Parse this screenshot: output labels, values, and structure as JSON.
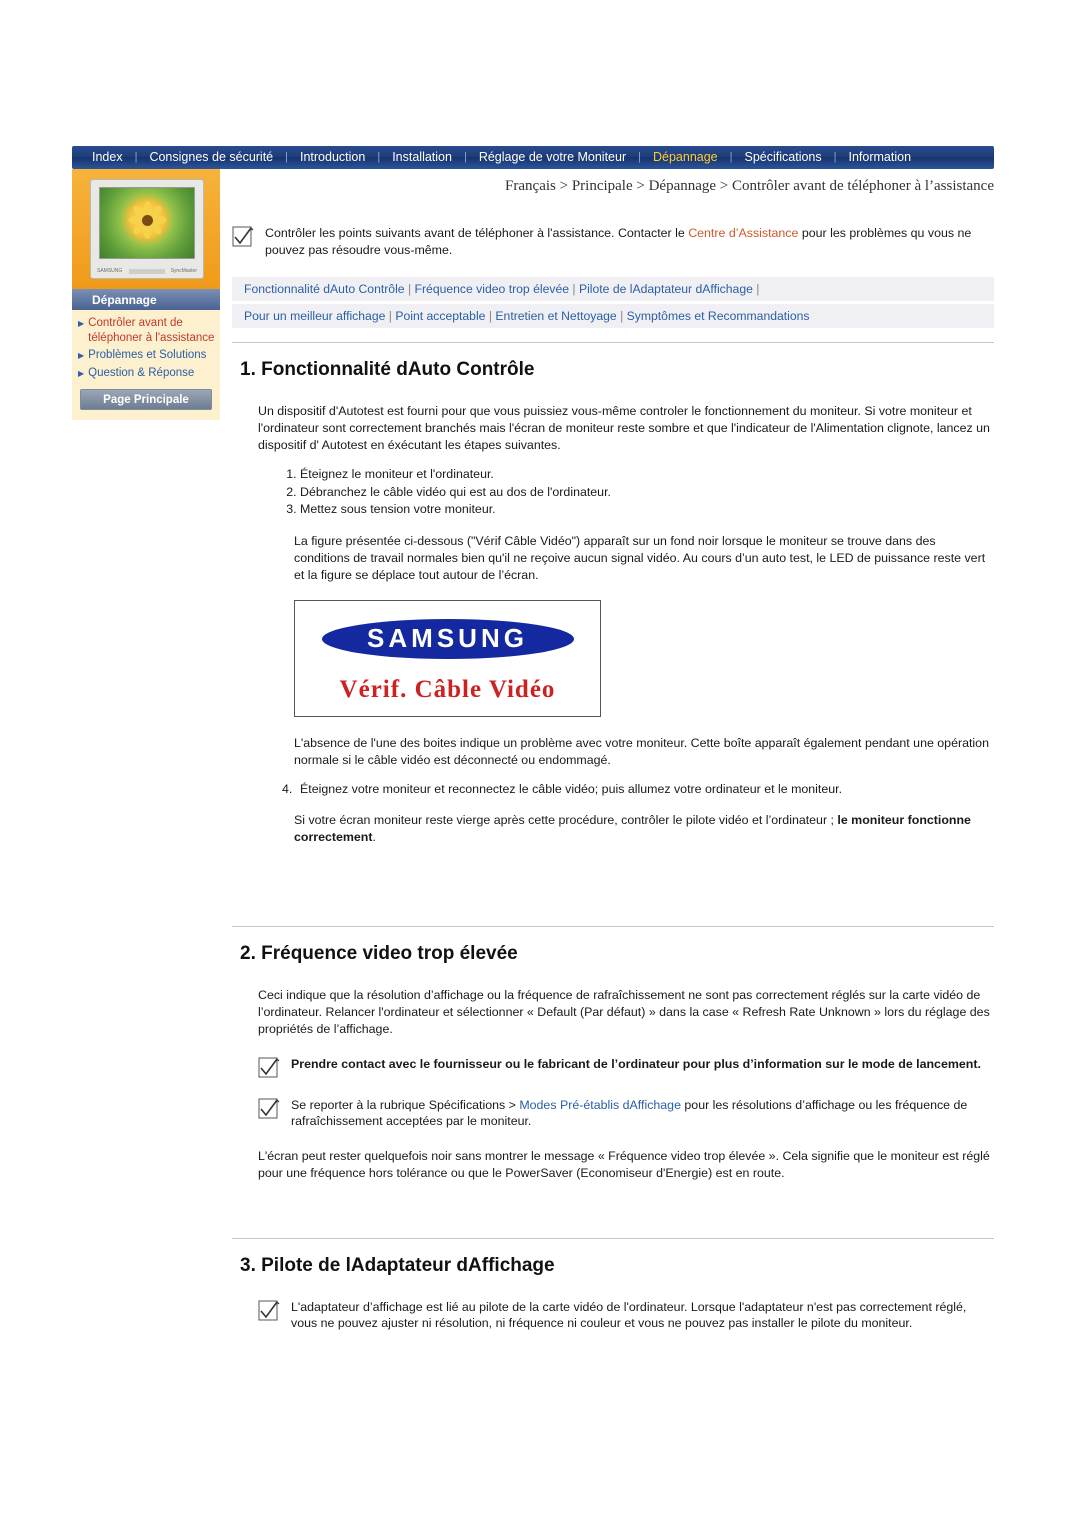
{
  "nav": {
    "items": [
      {
        "label": "Index",
        "active": false
      },
      {
        "label": "Consignes de sécurité",
        "active": false
      },
      {
        "label": "Introduction",
        "active": false
      },
      {
        "label": "Installation",
        "active": false
      },
      {
        "label": "Réglage de votre Moniteur",
        "active": false
      },
      {
        "label": "Dépannage",
        "active": true
      },
      {
        "label": "Spécifications",
        "active": false
      },
      {
        "label": "Information",
        "active": false
      }
    ]
  },
  "sidebar": {
    "monitor_label_left": "SAMSUNG",
    "monitor_label_right": "SyncMaster",
    "section_title": "Dépannage",
    "links": [
      {
        "label": "Contrôler avant de téléphoner à l'assistance",
        "style": "red"
      },
      {
        "label": "Problèmes et Solutions",
        "style": "blue"
      },
      {
        "label": "Question & Réponse",
        "style": "blue"
      }
    ],
    "main_button": "Page Principale"
  },
  "breadcrumb": "Français > Principale > Dépannage > Contrôler avant de téléphoner à l’assistance",
  "intro": {
    "text_1": "Contrôler les points suivants avant de téléphoner à l'assistance. Contacter le ",
    "link": "Centre d’Assistance",
    "text_2": " pour les problèmes qu vous ne pouvez pas résoudre vous-même."
  },
  "linkbar1": {
    "l1": "Fonctionnalité dAuto Contrôle",
    "l2": "Fréquence video trop élevée",
    "l3": "Pilote de lAdaptateur dAffichage"
  },
  "linkbar2": {
    "l1": "Pour un meilleur affichage",
    "l2": "Point acceptable",
    "l3": "Entretien et Nettoyage",
    "l4": "Symptômes et Recommandations"
  },
  "section1": {
    "heading": "1. Fonctionnalité dAuto Contrôle",
    "p1": "Un dispositif d'Autotest est fourni pour que vous puissiez vous-même controler le fonctionnement du moniteur. Si votre moniteur et l'ordinateur sont correctement branchés mais l'écran de moniteur reste sombre et que l'indicateur de l'Alimentation clignote, lancez un dispositif d' Autotest en éxécutant les étapes suivantes.",
    "steps": [
      "Éteignez le moniteur et l'ordinateur.",
      "Débranchez le câble vidéo qui est au dos de l'ordinateur.",
      "Mettez sous tension votre moniteur."
    ],
    "p2": "La figure présentée ci-dessous (\"Vérif Câble Vidéo\") apparaît sur un fond noir lorsque le moniteur se trouve dans des conditions de travail normales bien qu'il ne reçoive aucun signal vidéo. Au cours d’un auto test, le LED de puissance reste vert et la figure se déplace tout autour de l’écran.",
    "figure": {
      "brand": "SAMSUNG",
      "caption": "Vérif. Câble Vidéo"
    },
    "p3": "L'absence de l'une des boites indique un problème avec votre moniteur. Cette boîte apparaît également pendant une opération normale si le câble vidéo est déconnecté ou endommagé.",
    "step4_num": "4.",
    "step4": "Éteignez votre moniteur et reconnectez le câble vidéo; puis allumez votre ordinateur et le moniteur.",
    "p4_a": "Si votre écran moniteur reste vierge après cette procédure, contrôler le pilote vidéo et l’ordinateur ; ",
    "p4_b": "le moniteur fonctionne correctement",
    "p4_c": "."
  },
  "section2": {
    "heading": "2. Fréquence video trop élevée",
    "p1": "Ceci indique que la résolution d’affichage ou la fréquence de rafraîchissement ne sont pas correctement réglés sur la carte vidéo de l’ordinateur. Relancer l'ordinateur et sélectionner « Default (Par défaut) » dans la case « Refresh Rate Unknown » lors du réglage des propriétés de l’affichage.",
    "note1": "Prendre contact avec le fournisseur ou le fabricant de l’ordinateur pour plus d’information sur le mode de lancement.",
    "note2_a": "Se reporter à la rubrique Spécifications > ",
    "note2_link": "Modes Pré-établis dAffichage",
    "note2_b": " pour les résolutions d’affichage ou les fréquence de rafraîchissement acceptées par le moniteur.",
    "p2": "L'écran peut rester quelquefois noir sans montrer le message « Fréquence video trop élevée ». Cela signifie que le moniteur est réglé pour une fréquence hors tolérance ou que le PowerSaver (Economiseur d'Energie) est en route."
  },
  "section3": {
    "heading": "3. Pilote de lAdaptateur dAffichage",
    "note": "L'adaptateur d’affichage est lié au pilote de la carte vidéo de l'ordinateur. Lorsque l'adaptateur n'est pas correctement réglé, vous ne pouvez ajuster ni résolution, ni fréquence ni couleur et vous ne pouvez pas installer le pilote du moniteur."
  }
}
